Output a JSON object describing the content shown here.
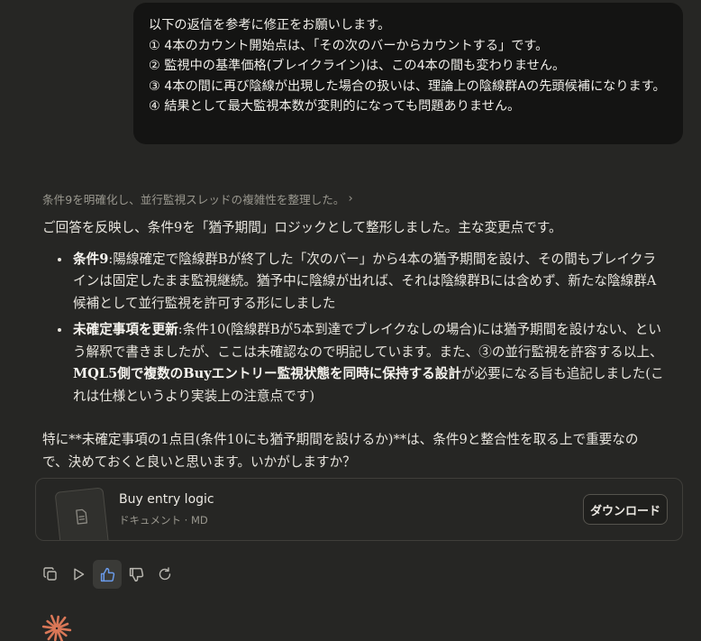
{
  "user_message": {
    "lines": [
      "以下の返信を参考に修正をお願いします。",
      "① 4本のカウント開始点は、「その次のバーからカウントする」です。",
      "② 監視中の基準価格(ブレイクライン)は、この4本の間も変わりません。",
      " ③ 4本の間に再び陰線が出現した場合の扱いは、理論上の陰線群Aの先頭候補になります。",
      " ④ 結果として最大監視本数が変則的になっても問題ありません。"
    ]
  },
  "thinking_summary": "条件9を明確化し、並行監視スレッドの複雑性を整理した。",
  "reply": {
    "intro": "ご回答を反映し、条件9を「猶予期間」ロジックとして整形しました。主な変更点です。",
    "bullets": [
      {
        "bold": "条件9",
        "text": ":陽線確定で陰線群Bが終了した「次のバー」から4本の猶予期間を設け、その間もブレイクラインは固定したまま監視継続。猶予中に陰線が出れば、それは陰線群Bには含めず、新たな陰線群A候補として並行監視を許可する形にしました"
      },
      {
        "bold": "未確定事項を更新",
        "text_before": ":条件10(陰線群Bが5本到達でブレイクなしの場合)には猶予期間を設けない、という解釈で書きましたが、ここは未確認なので明記しています。また、③の並行監視を許容する以上、",
        "bold2": "MQL5側で複数のBuyエントリー監視状態を同時に保持する設計",
        "text_after": "が必要になる旨も追記しました(これは仕様というより実装上の注意点です)"
      }
    ],
    "closing": "特に**未確定事項の1点目(条件10にも猶予期間を設けるか)**は、条件9と整合性を取る上で重要なので、決めておくと良いと思います。いかがしますか？"
  },
  "attachment": {
    "title": "Buy entry logic",
    "subtitle": "ドキュメント · MD",
    "download_label": "ダウンロード"
  },
  "actions": {
    "icons": [
      "copy-icon",
      "play-icon",
      "thumbs-up-icon",
      "thumbs-down-icon",
      "retry-icon"
    ],
    "active": "thumbs-up-icon"
  },
  "colors": {
    "background": "#262624",
    "bubble": "#141413",
    "accent": "#d97757",
    "thumbs_active": "#6a9bea"
  }
}
